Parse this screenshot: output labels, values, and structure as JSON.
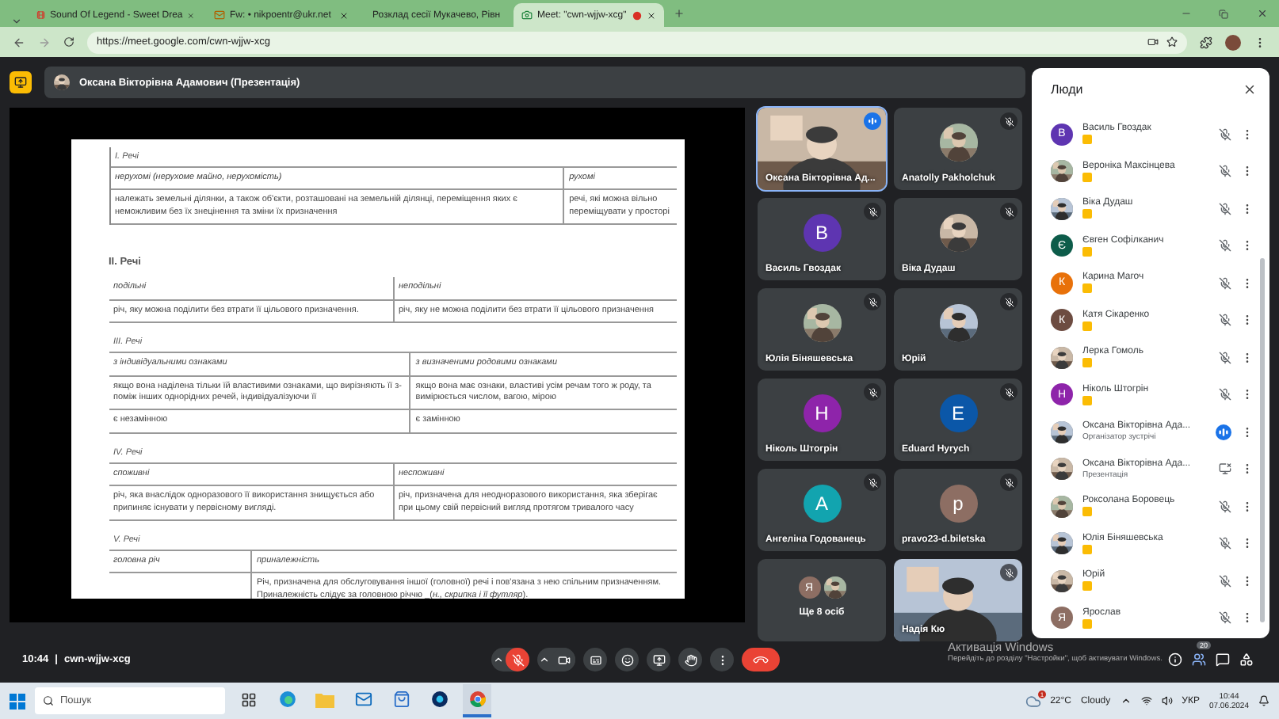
{
  "browser": {
    "tabs": [
      {
        "title": "Sound Of Legend - Sweet Drea",
        "kind": "video",
        "selected": false,
        "recording": false
      },
      {
        "title": "Fw: • nikpoentr@ukr.net",
        "kind": "mail",
        "selected": false,
        "recording": false
      },
      {
        "title": "Розклад сесії Мукачево, Рівн",
        "kind": "doc",
        "selected": false,
        "recording": false
      },
      {
        "title": "Meet: \"cwn-wjjw-xcg\"",
        "kind": "meet",
        "selected": true,
        "recording": true
      }
    ],
    "url": "https://meet.google.com/cwn-wjjw-xcg"
  },
  "presenter": {
    "label": "Оксана Вікторівна Адамович (Презентація)"
  },
  "slide": {
    "items": [
      {
        "kind": "table",
        "heading": "I. Речі",
        "rows": [
          [
            "нерухомі (нерухоме майно, нерухомість)",
            "рухомі"
          ],
          [
            "належать земельні ділянки, а також об'єкти, розташовані на земельній ділянці, переміщення яких є неможливим без їх знецінення та зміни їх призначення",
            "речі, які можна вільно переміщувати у просторі"
          ]
        ]
      },
      {
        "kind": "bar"
      },
      {
        "kind": "title",
        "text": "II. Речі"
      },
      {
        "kind": "table",
        "rows": [
          [
            "подільні",
            "неподільні"
          ],
          [
            "річ, яку можна поділити без втрати її цільового призначення.",
            "річ, яку не можна поділити без втрати її цільового призначення"
          ]
        ]
      },
      {
        "kind": "table",
        "heading": "III. Речі",
        "rows": [
          [
            "з індивідуальними ознаками",
            "з визначеними родовими ознаками"
          ],
          [
            "якщо вона наділена тільки їй властивими ознаками, що вирізняють її з-поміж інших однорідних речей, індивідуалізуючи її",
            "якщо вона має ознаки, властиві усім речам того ж роду, та вимірюється числом, вагою, мірою"
          ],
          [
            "є незамінною",
            "є замінною"
          ]
        ]
      },
      {
        "kind": "table",
        "heading": "IV. Речі",
        "rows": [
          [
            "споживні",
            "неспоживні"
          ],
          [
            "річ, яка внаслідок одноразового її використання знищується або припиняє існувати у первісному вигляді.",
            "річ, призначена для неодноразового використання, яка зберігає при цьому свій первісний вигляд протягом тривалого часу"
          ]
        ]
      },
      {
        "kind": "table",
        "heading": "V. Речі",
        "rows": [
          [
            "головна річ",
            "приналежність"
          ],
          [
            "",
            "Річ, призначена для обслуговування іншої (головної) речі і пов'язана з нею спільним призначенням. Приналежність слідує за головною річчю _(*н., скрипка і її футляр*)."
          ]
        ]
      }
    ]
  },
  "tiles": [
    {
      "name": "Оксана Вікторівна Ад...",
      "avatar": {
        "kind": "video"
      },
      "muted": false
    },
    {
      "name": "Anatolly Pakholchuk",
      "muted": true
    },
    {
      "name": "Василь Гвоздак",
      "avatar": {
        "kind": "letter",
        "letter": "B",
        "color": "#5e35b1"
      },
      "muted": true
    },
    {
      "name": "Віка Дудаш",
      "muted": true
    },
    {
      "name": "Юлія Біняшевська",
      "muted": true
    },
    {
      "name": "Юрій",
      "muted": true
    },
    {
      "name": "Ніколь Штогрін",
      "avatar": {
        "kind": "letter",
        "letter": "H",
        "color": "#8e24aa"
      },
      "muted": true
    },
    {
      "name": "Eduard Hyrych",
      "avatar": {
        "kind": "letter",
        "letter": "E",
        "color": "#0b57a8"
      },
      "muted": true
    },
    {
      "name": "Ангеліна Годованець",
      "avatar": {
        "kind": "letter",
        "letter": "A",
        "color": "#12a4af"
      },
      "muted": true
    },
    {
      "name": "pravo23-d.biletska",
      "avatar": {
        "kind": "letter",
        "letter": "p",
        "color": "#8d6e63"
      },
      "muted": true
    },
    {
      "name": "Ще 8 осіб",
      "avatar": {
        "kind": "group",
        "letter": "Я",
        "color": "#8d6e63"
      }
    },
    {
      "name": "Надія Кю",
      "avatar": {
        "kind": "video"
      },
      "muted": true
    }
  ],
  "people": {
    "title": "Люди",
    "items": [
      {
        "kind": "person",
        "name": "Василь Гвоздак",
        "avatar": {
          "kind": "letter",
          "letter": "B",
          "color": "#5e35b1"
        },
        "muted": true
      },
      {
        "kind": "person",
        "name": "Вероніка Максінцева",
        "muted": true
      },
      {
        "kind": "person",
        "name": "Віка Дудаш",
        "muted": true
      },
      {
        "kind": "person",
        "name": "Євген Софілканич",
        "avatar": {
          "kind": "letter",
          "letter": "Є",
          "color": "#0d5c4a"
        },
        "muted": true
      },
      {
        "kind": "person",
        "name": "Карина Магоч",
        "avatar": {
          "kind": "letter",
          "letter": "К",
          "color": "#e8710a"
        },
        "muted": true
      },
      {
        "kind": "person",
        "name": "Катя Сікаренко",
        "avatar": {
          "kind": "letter",
          "letter": "К",
          "color": "#6d4c41"
        },
        "muted": true
      },
      {
        "kind": "person",
        "name": "Лерка Гомоль",
        "muted": true
      },
      {
        "kind": "person",
        "name": "Ніколь Штогрін",
        "avatar": {
          "kind": "letter",
          "letter": "Н",
          "color": "#8e24aa"
        },
        "muted": true
      },
      {
        "kind": "person",
        "name": "Оксана Вікторівна Ада...",
        "subtitle": "Організатор зустрічі",
        "muted": false
      },
      {
        "kind": "presentation",
        "name": "Оксана Вікторівна Ада...",
        "subtitle": "Презентація",
        "muted": true
      },
      {
        "kind": "person",
        "name": "Роксолана Боровець",
        "muted": true
      },
      {
        "kind": "person",
        "name": "Юлія Біняшевська",
        "muted": true
      },
      {
        "kind": "person",
        "name": "Юрій",
        "muted": true
      },
      {
        "kind": "person",
        "name": "Ярослав",
        "avatar": {
          "kind": "letter",
          "letter": "Я",
          "color": "#8d6e63"
        },
        "muted": true
      }
    ]
  },
  "bottom_bar": {
    "time": "10:44",
    "separator": "|",
    "meeting_code": "cwn-wjjw-xcg",
    "controls": [
      {
        "kind": "mic",
        "muted": true
      },
      {
        "kind": "camera",
        "muted": false
      },
      {
        "kind": "captions"
      },
      {
        "kind": "reactions"
      },
      {
        "kind": "present"
      },
      {
        "kind": "hand"
      },
      {
        "kind": "more"
      },
      {
        "kind": "leave"
      }
    ],
    "people_count": "20"
  },
  "activation": {
    "title": "Активація Windows",
    "text": "Перейдіть до розділу \"Настройки\", щоб активувати Windows."
  },
  "taskbar": {
    "search_placeholder": "Пошук",
    "apps": [
      {
        "kind": "taskview",
        "selected": false
      },
      {
        "kind": "edge",
        "selected": false
      },
      {
        "kind": "explorer",
        "selected": false
      },
      {
        "kind": "mail",
        "selected": false
      },
      {
        "kind": "store",
        "selected": false
      },
      {
        "kind": "webex",
        "selected": false
      },
      {
        "kind": "chrome",
        "selected": true
      }
    ],
    "weather_badge": "1",
    "temperature": "22°C",
    "weather": "Cloudy",
    "language": "УКР",
    "time": "10:44",
    "date": "07.06.2024"
  }
}
